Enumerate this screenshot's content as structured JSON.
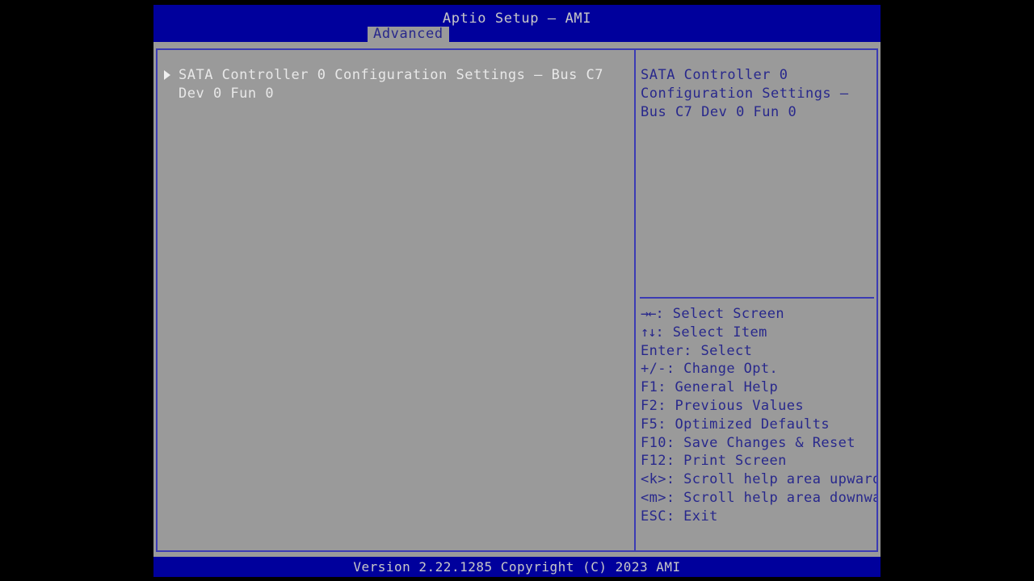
{
  "header": {
    "title": "Aptio Setup – AMI",
    "tabs": [
      {
        "label": "Advanced",
        "selected": true
      }
    ]
  },
  "main": {
    "items": [
      {
        "label": "SATA Controller 0 Configuration Settings – Bus C7 Dev 0 Fun 0",
        "has_submenu": true,
        "selected": true
      }
    ]
  },
  "help": {
    "description": "SATA Controller 0 Configuration Settings – Bus C7 Dev 0 Fun 0",
    "keys": [
      {
        "glyph": "→←",
        "text": ": Select Screen"
      },
      {
        "glyph": "↑↓",
        "text": ": Select Item"
      },
      {
        "glyph": "",
        "text": "Enter: Select"
      },
      {
        "glyph": "",
        "text": "+/-: Change Opt."
      },
      {
        "glyph": "",
        "text": "F1: General Help"
      },
      {
        "glyph": "",
        "text": "F2: Previous Values"
      },
      {
        "glyph": "",
        "text": "F5: Optimized Defaults"
      },
      {
        "glyph": "",
        "text": "F10: Save Changes & Reset"
      },
      {
        "glyph": "",
        "text": "F12: Print Screen"
      },
      {
        "glyph": "",
        "text": "<k>: Scroll help area upwards"
      },
      {
        "glyph": "",
        "text": "<m>: Scroll help area downwards"
      },
      {
        "glyph": "",
        "text": "ESC: Exit"
      }
    ]
  },
  "footer": {
    "version": "Version 2.22.1285 Copyright (C) 2023 AMI"
  },
  "colors": {
    "bios_blue": "#00009c",
    "panel_gray": "#9a9a9a",
    "border_blue": "#3b3bb4",
    "help_text": "#28288c",
    "menu_text": "#e8e8e8",
    "header_text": "#c8c8c8"
  }
}
